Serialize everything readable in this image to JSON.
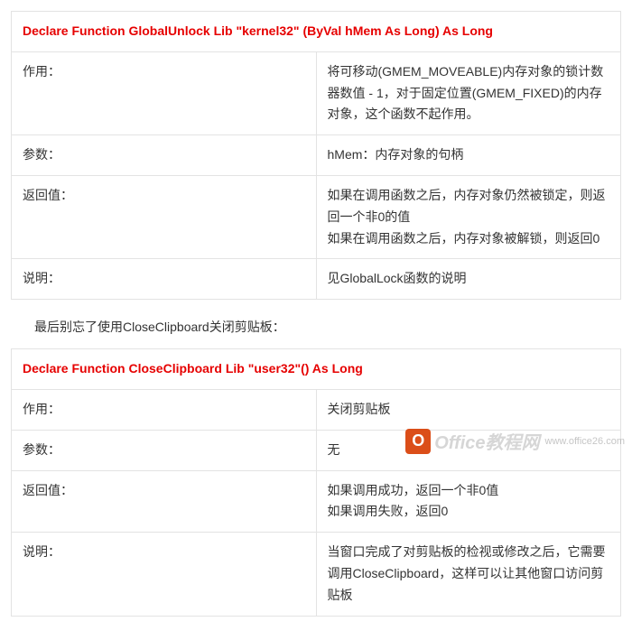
{
  "table1": {
    "declaration": "Declare Function GlobalUnlock Lib \"kernel32\" (ByVal hMem As Long) As Long",
    "rows": [
      {
        "label": "作用：",
        "value": "将可移动(GMEM_MOVEABLE)内存对象的锁计数器数值 - 1，对于固定位置(GMEM_FIXED)的内存对象，这个函数不起作用。"
      },
      {
        "label": "参数：",
        "value": "hMem：内存对象的句柄"
      },
      {
        "label": "返回值：",
        "value": "如果在调用函数之后，内存对象仍然被锁定，则返回一个非0的值\n如果在调用函数之后，内存对象被解锁，则返回0"
      },
      {
        "label": "说明：",
        "value": "见GlobalLock函数的说明"
      }
    ]
  },
  "intertext": "最后别忘了使用CloseClipboard关闭剪贴板：",
  "table2": {
    "declaration": "Declare Function CloseClipboard Lib \"user32\"() As Long",
    "rows": [
      {
        "label": "作用：",
        "value": "关闭剪贴板"
      },
      {
        "label": "参数：",
        "value": "无"
      },
      {
        "label": "返回值：",
        "value": "如果调用成功，返回一个非0值\n如果调用失败，返回0"
      },
      {
        "label": "说明：",
        "value": "当窗口完成了对剪贴板的检视或修改之后，它需要调用CloseClipboard，这样可以让其他窗口访问剪贴板"
      }
    ]
  },
  "watermark": {
    "brand": "Office教程网",
    "url": "www.office26.com",
    "icon_letter": "O"
  }
}
